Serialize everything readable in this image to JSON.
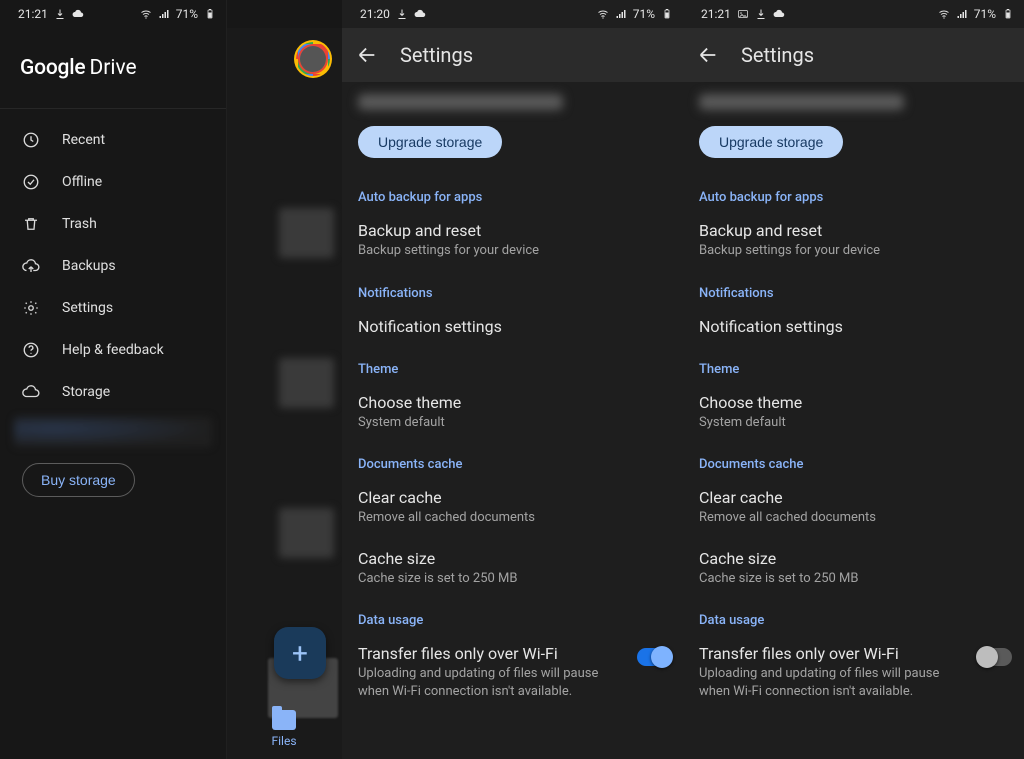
{
  "status": {
    "left": {
      "time": "21:21",
      "battery": "71%"
    },
    "mid": {
      "time": "21:20",
      "battery": "71%"
    },
    "right": {
      "time": "21:21",
      "battery": "71%"
    }
  },
  "drawer": {
    "brand_bold": "Google",
    "brand_light": "Drive",
    "items": [
      {
        "label": "Recent"
      },
      {
        "label": "Offline"
      },
      {
        "label": "Trash"
      },
      {
        "label": "Backups"
      },
      {
        "label": "Settings"
      },
      {
        "label": "Help & feedback"
      },
      {
        "label": "Storage"
      }
    ],
    "buy_label": "Buy storage"
  },
  "behind": {
    "bottom_tab": "Files"
  },
  "settings": {
    "title": "Settings",
    "upgrade_label": "Upgrade storage",
    "sections": {
      "auto_backup": "Auto backup for apps",
      "notifications": "Notifications",
      "theme": "Theme",
      "cache": "Documents cache",
      "data_usage": "Data usage"
    },
    "rows": {
      "backup_reset": {
        "title": "Backup and reset",
        "sub": "Backup settings for your device"
      },
      "notification_set": {
        "title": "Notification settings"
      },
      "choose_theme": {
        "title": "Choose theme",
        "sub": "System default"
      },
      "clear_cache": {
        "title": "Clear cache",
        "sub": "Remove all cached documents"
      },
      "cache_size": {
        "title": "Cache size",
        "sub": "Cache size is set to 250 MB"
      },
      "wifi_only": {
        "title": "Transfer files only over Wi-Fi",
        "sub": "Uploading and updating of files will pause when Wi-Fi connection isn't available."
      }
    }
  }
}
